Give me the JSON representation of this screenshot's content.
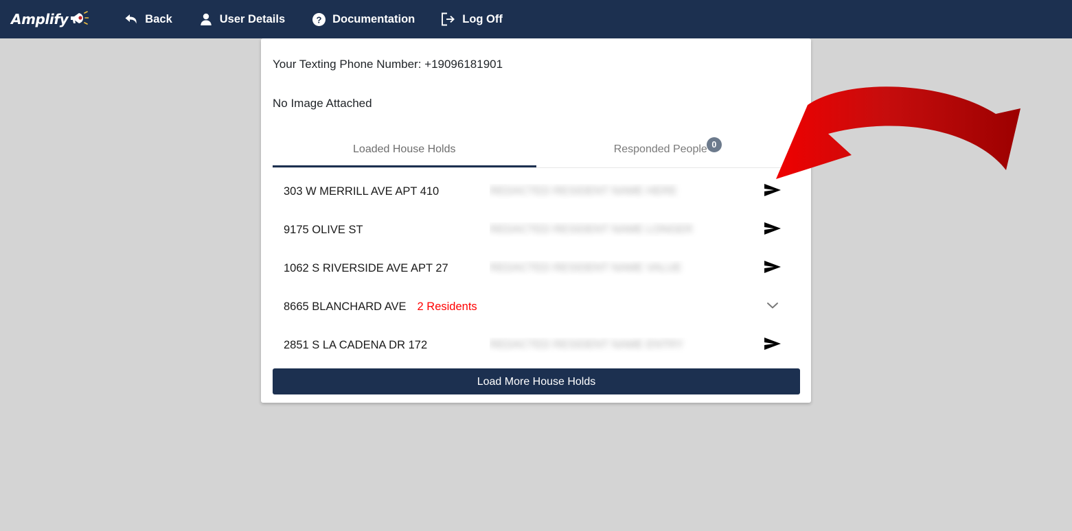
{
  "navbar": {
    "brand": {
      "text": "Amplify",
      "icon": "megaphone-icon"
    },
    "links": [
      {
        "label": "Back",
        "icon": "back-arrow-icon"
      },
      {
        "label": "User Details",
        "icon": "user-icon"
      },
      {
        "label": "Documentation",
        "icon": "question-circle-icon"
      },
      {
        "label": "Log Off",
        "icon": "sign-out-icon"
      }
    ]
  },
  "card": {
    "phone_line": "Your Texting Phone Number: +19096181901",
    "image_line": "No Image Attached",
    "tabs": [
      {
        "label": "Loaded House Holds",
        "active": true,
        "badge": null
      },
      {
        "label": "Responded People",
        "active": false,
        "badge": "0"
      }
    ],
    "households": [
      {
        "address": "303 W MERRILL AVE APT 410",
        "name_redacted": "REDACTED RESIDENT NAME HERE",
        "residents": null,
        "action_icon": "send-icon"
      },
      {
        "address": "9175 OLIVE ST",
        "name_redacted": "REDACTED RESIDENT NAME LONGER",
        "residents": null,
        "action_icon": "send-icon"
      },
      {
        "address": "1062 S RIVERSIDE AVE APT 27",
        "name_redacted": "REDACTED RESIDENT NAME VALUE",
        "residents": null,
        "action_icon": "send-icon"
      },
      {
        "address": "8665 BLANCHARD AVE",
        "name_redacted": "",
        "residents": "2 Residents",
        "action_icon": "chevron-down-icon"
      },
      {
        "address": "2851 S LA CADENA DR 172",
        "name_redacted": "REDACTED RESIDENT NAME ENTRY",
        "residents": null,
        "action_icon": "send-icon"
      }
    ],
    "load_more_label": "Load More House Holds"
  },
  "annotation": {
    "type": "curved-arrow",
    "color": "#c40000",
    "points_to": "first-row-send-icon"
  },
  "colors": {
    "navy": "#1c3050",
    "page_bg": "#d4d4d4",
    "card_bg": "#ffffff",
    "residents_red": "#ff0000",
    "annotation_red": "#c40000",
    "badge_gray": "#6c7a8c"
  }
}
